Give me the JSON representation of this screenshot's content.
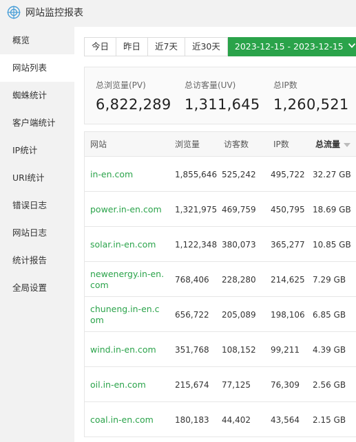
{
  "app": {
    "title": "网站监控报表",
    "logo_icon": "globe-target-icon",
    "accent": "#2aa34a"
  },
  "sidebar": {
    "items": [
      {
        "label": "概览",
        "active": false
      },
      {
        "label": "网站列表",
        "active": true
      },
      {
        "label": "蜘蛛统计",
        "active": false
      },
      {
        "label": "客户端统计",
        "active": false
      },
      {
        "label": "IP统计",
        "active": false
      },
      {
        "label": "URI统计",
        "active": false
      },
      {
        "label": "错误日志",
        "active": false
      },
      {
        "label": "网站日志",
        "active": false
      },
      {
        "label": "统计报告",
        "active": false
      },
      {
        "label": "全局设置",
        "active": false
      }
    ]
  },
  "range": {
    "buttons": [
      "今日",
      "昨日",
      "近7天",
      "近30天"
    ],
    "date_range": "2023-12-15 - 2023-12-15",
    "date_icon": "chevron-down-icon"
  },
  "summary": {
    "pv": {
      "label": "总浏览量(PV)",
      "value": "6,822,289"
    },
    "uv": {
      "label": "总访客量(UV)",
      "value": "1,311,645"
    },
    "ip": {
      "label": "总IP数",
      "value": "1,260,521"
    }
  },
  "table": {
    "headers": {
      "site": "网站",
      "pv": "浏览量",
      "uv": "访客数",
      "ip": "IP数",
      "traffic": "总流量"
    },
    "sorted_column": "traffic",
    "rows": [
      {
        "site": "in-en.com",
        "pv": "1,855,646",
        "uv": "525,242",
        "ip": "495,722",
        "traffic": "32.27 GB"
      },
      {
        "site": "power.in-en.com",
        "pv": "1,321,975",
        "uv": "469,759",
        "ip": "450,795",
        "traffic": "18.69 GB"
      },
      {
        "site": "solar.in-en.com",
        "pv": "1,122,348",
        "uv": "380,073",
        "ip": "365,277",
        "traffic": "10.85 GB"
      },
      {
        "site": "newenergy.in-en.com",
        "pv": "768,406",
        "uv": "228,280",
        "ip": "214,625",
        "traffic": "7.29 GB"
      },
      {
        "site": "chuneng.in-en.com",
        "pv": "656,722",
        "uv": "205,089",
        "ip": "198,106",
        "traffic": "6.85 GB"
      },
      {
        "site": "wind.in-en.com",
        "pv": "351,768",
        "uv": "108,152",
        "ip": "99,211",
        "traffic": "4.39 GB"
      },
      {
        "site": "oil.in-en.com",
        "pv": "215,674",
        "uv": "77,125",
        "ip": "76,309",
        "traffic": "2.56 GB"
      },
      {
        "site": "coal.in-en.com",
        "pv": "180,183",
        "uv": "44,402",
        "ip": "43,564",
        "traffic": "2.15 GB"
      }
    ]
  }
}
